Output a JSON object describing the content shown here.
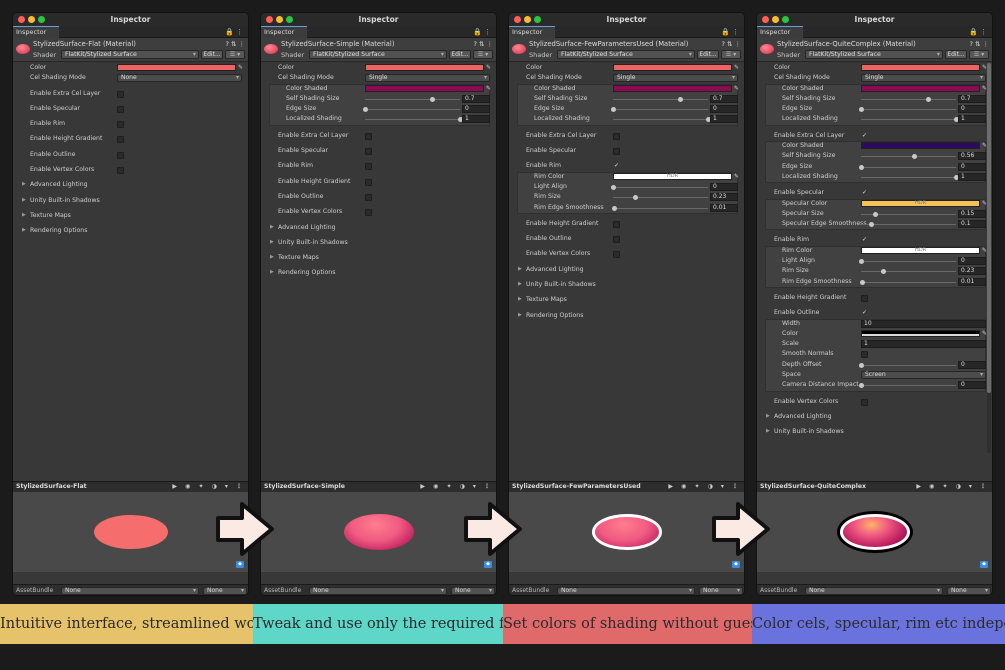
{
  "window_title": "Inspector",
  "tab_label": "Inspector",
  "shader_label": "Shader",
  "shader_value": "FlatKit/Stylized Surface",
  "edit_label": "Edit...",
  "list_label": "☰ ▾",
  "asset_bundle_label": "AssetBundle",
  "asset_bundle_value": "None",
  "asset_variant_value": "None",
  "colors": {
    "red": "#f06262",
    "magenta": "#8c0a52",
    "purple": "#2e0a5e",
    "yellow": "#f5c158",
    "white": "#ffffff",
    "black": "#000000"
  },
  "panels": [
    {
      "material": "StylizedSurface-Flat (Material)",
      "preview_title": "StylizedSurface-Flat",
      "rows": [
        {
          "t": "color",
          "l": "Color",
          "c": "#f06262"
        },
        {
          "t": "drop",
          "l": "Cel Shading Mode",
          "v": "None"
        },
        {
          "t": "sp"
        },
        {
          "t": "check",
          "l": "Enable Extra Cel Layer",
          "on": false
        },
        {
          "t": "sp"
        },
        {
          "t": "check",
          "l": "Enable Specular",
          "on": false
        },
        {
          "t": "sp"
        },
        {
          "t": "check",
          "l": "Enable Rim",
          "on": false
        },
        {
          "t": "sp"
        },
        {
          "t": "check",
          "l": "Enable Height Gradient",
          "on": false
        },
        {
          "t": "sp"
        },
        {
          "t": "check",
          "l": "Enable Outline",
          "on": false
        },
        {
          "t": "sp"
        },
        {
          "t": "check",
          "l": "Enable Vertex Colors",
          "on": false
        },
        {
          "t": "sp"
        },
        {
          "t": "fold",
          "l": "Advanced Lighting"
        },
        {
          "t": "sp"
        },
        {
          "t": "fold",
          "l": "Unity Built-in Shadows"
        },
        {
          "t": "sp"
        },
        {
          "t": "fold",
          "l": "Texture Maps"
        },
        {
          "t": "sp"
        },
        {
          "t": "fold",
          "l": "Rendering Options"
        }
      ]
    },
    {
      "material": "StylizedSurface-Simple (Material)",
      "preview_title": "StylizedSurface-Simple",
      "rows": [
        {
          "t": "color",
          "l": "Color",
          "c": "#f06262"
        },
        {
          "t": "drop",
          "l": "Cel Shading Mode",
          "v": "Single"
        },
        {
          "t": "box",
          "h": 4,
          "items": [
            {
              "t": "color",
              "l": "Color Shaded",
              "c": "#8c0a52"
            },
            {
              "t": "slider",
              "l": "Self Shading Size",
              "v": "0.7",
              "p": 0.7
            },
            {
              "t": "slider",
              "l": "Edge Size",
              "v": "0",
              "p": 0
            },
            {
              "t": "slider",
              "l": "Localized Shading",
              "v": "1",
              "p": 1
            }
          ]
        },
        {
          "t": "sp"
        },
        {
          "t": "check",
          "l": "Enable Extra Cel Layer",
          "on": false
        },
        {
          "t": "sp"
        },
        {
          "t": "check",
          "l": "Enable Specular",
          "on": false
        },
        {
          "t": "sp"
        },
        {
          "t": "check",
          "l": "Enable Rim",
          "on": false
        },
        {
          "t": "sp"
        },
        {
          "t": "check",
          "l": "Enable Height Gradient",
          "on": false
        },
        {
          "t": "sp"
        },
        {
          "t": "check",
          "l": "Enable Outline",
          "on": false
        },
        {
          "t": "sp"
        },
        {
          "t": "check",
          "l": "Enable Vertex Colors",
          "on": false
        },
        {
          "t": "sp"
        },
        {
          "t": "fold",
          "l": "Advanced Lighting"
        },
        {
          "t": "sp"
        },
        {
          "t": "fold",
          "l": "Unity Built-in Shadows"
        },
        {
          "t": "sp"
        },
        {
          "t": "fold",
          "l": "Texture Maps"
        },
        {
          "t": "sp"
        },
        {
          "t": "fold",
          "l": "Rendering Options"
        }
      ]
    },
    {
      "material": "StylizedSurface-FewParametersUsed (Material)",
      "preview_title": "StylizedSurface-FewParametersUsed",
      "rows": [
        {
          "t": "color",
          "l": "Color",
          "c": "#f06262"
        },
        {
          "t": "drop",
          "l": "Cel Shading Mode",
          "v": "Single"
        },
        {
          "t": "box",
          "h": 4,
          "items": [
            {
              "t": "color",
              "l": "Color Shaded",
              "c": "#8c0a52"
            },
            {
              "t": "slider",
              "l": "Self Shading Size",
              "v": "0.7",
              "p": 0.7
            },
            {
              "t": "slider",
              "l": "Edge Size",
              "v": "0",
              "p": 0
            },
            {
              "t": "slider",
              "l": "Localized Shading",
              "v": "1",
              "p": 1
            }
          ]
        },
        {
          "t": "sp"
        },
        {
          "t": "check",
          "l": "Enable Extra Cel Layer",
          "on": false
        },
        {
          "t": "sp"
        },
        {
          "t": "check",
          "l": "Enable Specular",
          "on": false
        },
        {
          "t": "sp"
        },
        {
          "t": "check",
          "l": "Enable Rim",
          "on": true
        },
        {
          "t": "box",
          "h": 4,
          "items": [
            {
              "t": "color",
              "l": "Rim Color",
              "c": "#ffffff",
              "hdr": "HDR"
            },
            {
              "t": "slider",
              "l": "Light Align",
              "v": "0",
              "p": 0
            },
            {
              "t": "slider",
              "l": "Rim Size",
              "v": "0.23",
              "p": 0.23
            },
            {
              "t": "slider",
              "l": "Rim Edge Smoothness",
              "v": "0.01",
              "p": 0.01
            }
          ]
        },
        {
          "t": "sp"
        },
        {
          "t": "check",
          "l": "Enable Height Gradient",
          "on": false
        },
        {
          "t": "sp"
        },
        {
          "t": "check",
          "l": "Enable Outline",
          "on": false
        },
        {
          "t": "sp"
        },
        {
          "t": "check",
          "l": "Enable Vertex Colors",
          "on": false
        },
        {
          "t": "sp"
        },
        {
          "t": "fold",
          "l": "Advanced Lighting"
        },
        {
          "t": "sp"
        },
        {
          "t": "fold",
          "l": "Unity Built-in Shadows"
        },
        {
          "t": "sp"
        },
        {
          "t": "fold",
          "l": "Texture Maps"
        },
        {
          "t": "sp"
        },
        {
          "t": "fold",
          "l": "Rendering Options"
        }
      ]
    },
    {
      "material": "StylizedSurface-QuiteComplex (Material)",
      "preview_title": "StylizedSurface-QuiteComplex",
      "rows": [
        {
          "t": "color",
          "l": "Color",
          "c": "#f06262"
        },
        {
          "t": "drop",
          "l": "Cel Shading Mode",
          "v": "Single"
        },
        {
          "t": "box",
          "h": 4,
          "items": [
            {
              "t": "color",
              "l": "Color Shaded",
              "c": "#8c0a52"
            },
            {
              "t": "slider",
              "l": "Self Shading Size",
              "v": "0.7",
              "p": 0.7
            },
            {
              "t": "slider",
              "l": "Edge Size",
              "v": "0",
              "p": 0
            },
            {
              "t": "slider",
              "l": "Localized Shading",
              "v": "1",
              "p": 1
            }
          ]
        },
        {
          "t": "sp"
        },
        {
          "t": "check",
          "l": "Enable Extra Cel Layer",
          "on": true
        },
        {
          "t": "box",
          "h": 4,
          "items": [
            {
              "t": "color",
              "l": "Color Shaded",
              "c": "#2e0a5e"
            },
            {
              "t": "slider",
              "l": "Self Shading Size",
              "v": "0.56",
              "p": 0.56
            },
            {
              "t": "slider",
              "l": "Edge Size",
              "v": "0",
              "p": 0
            },
            {
              "t": "slider",
              "l": "Localized Shading",
              "v": "1",
              "p": 1
            }
          ]
        },
        {
          "t": "sp"
        },
        {
          "t": "check",
          "l": "Enable Specular",
          "on": true
        },
        {
          "t": "box",
          "h": 3,
          "items": [
            {
              "t": "color",
              "l": "Specular Color",
              "c": "#f5c158",
              "hdr": "HDR"
            },
            {
              "t": "slider",
              "l": "Specular Size",
              "v": "0.15",
              "p": 0.15
            },
            {
              "t": "slider",
              "l": "Specular Edge Smoothness",
              "v": "0.1",
              "p": 0.1
            }
          ]
        },
        {
          "t": "sp"
        },
        {
          "t": "check",
          "l": "Enable Rim",
          "on": true
        },
        {
          "t": "box",
          "h": 4,
          "items": [
            {
              "t": "color",
              "l": "Rim Color",
              "c": "#ffffff",
              "hdr": "HDR"
            },
            {
              "t": "slider",
              "l": "Light Align",
              "v": "0",
              "p": 0
            },
            {
              "t": "slider",
              "l": "Rim Size",
              "v": "0.23",
              "p": 0.23
            },
            {
              "t": "slider",
              "l": "Rim Edge Smoothness",
              "v": "0.01",
              "p": 0.01
            }
          ]
        },
        {
          "t": "sp"
        },
        {
          "t": "check",
          "l": "Enable Height Gradient",
          "on": false
        },
        {
          "t": "sp"
        },
        {
          "t": "check",
          "l": "Enable Outline",
          "on": true
        },
        {
          "t": "box",
          "h": 7,
          "items": [
            {
              "t": "numw",
              "l": "Width",
              "v": "10"
            },
            {
              "t": "color",
              "l": "Color",
              "c": "#000000"
            },
            {
              "t": "numw",
              "l": "Scale",
              "v": "1"
            },
            {
              "t": "check",
              "l": "Smooth Normals",
              "on": false
            },
            {
              "t": "slider",
              "l": "Depth Offset",
              "v": "0",
              "p": 0
            },
            {
              "t": "drop",
              "l": "Space",
              "v": "Screen"
            },
            {
              "t": "slider",
              "l": "Camera Distance Impact",
              "v": "0",
              "p": 0
            }
          ]
        },
        {
          "t": "sp"
        },
        {
          "t": "check",
          "l": "Enable Vertex Colors",
          "on": false
        },
        {
          "t": "sp"
        },
        {
          "t": "fold",
          "l": "Advanced Lighting"
        },
        {
          "t": "sp"
        },
        {
          "t": "fold",
          "l": "Unity Built-in Shadows"
        }
      ]
    }
  ],
  "banners": [
    {
      "text": "Intuitive interface, streamlined workflow",
      "color": "#e6c36b"
    },
    {
      "text": "Tweak and use only the required features",
      "color": "#5ed6c8"
    },
    {
      "text": "Set colors of shading without guesswork",
      "color": "#e06a6a"
    },
    {
      "text": "Color cels, specular, rim etc independently",
      "color": "#6a73dd"
    }
  ]
}
